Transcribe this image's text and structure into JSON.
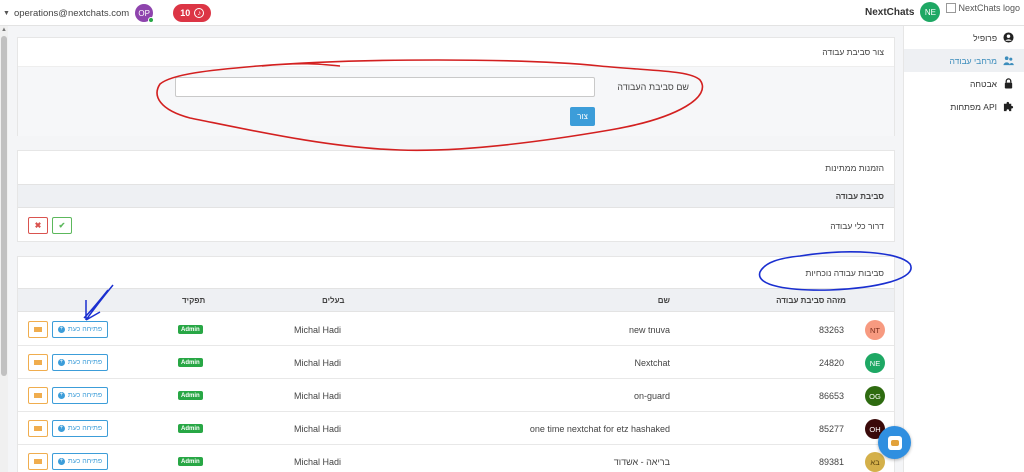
{
  "topbar": {
    "email": "operations@nextchats.com",
    "user_initials": "OP",
    "notifications_count": "10",
    "brand_name": "NextChats",
    "brand_initials": "NE",
    "logo_alt": "NextChats logo"
  },
  "sidebar": {
    "items": [
      {
        "label": "פרופיל",
        "icon": "user-circle-icon"
      },
      {
        "label": "מרחבי עבודה",
        "icon": "users-icon",
        "active": true
      },
      {
        "label": "אבטחה",
        "icon": "lock-icon"
      },
      {
        "label": "מפתחות API",
        "icon": "puzzle-icon"
      }
    ]
  },
  "create_workspace": {
    "title": "צור סביבת עבודה",
    "name_label": "שם סביבת העבודה",
    "name_value": "",
    "create_label": "צור"
  },
  "invitations": {
    "title": "הזמנות ממתינות",
    "column_header": "סביבת עבודה",
    "rows": [
      {
        "workspace": "דרור כלי עבודה",
        "reject_symbol": "✖",
        "accept_symbol": "✔"
      }
    ]
  },
  "workspaces": {
    "title": "סביבות עבודה נוכחיות",
    "columns": {
      "id": "מזהה סביבת עבודה",
      "name": "שם",
      "owners": "בעלים",
      "role": "תפקיד"
    },
    "open_label": "פתיחה כעת",
    "rows": [
      {
        "initials": "NT",
        "color": "#f79a80",
        "text_color": "#7a2e1c",
        "id": "83263",
        "name": "new tnuva",
        "owner": "Michal Hadi",
        "role": "Admin"
      },
      {
        "initials": "NE",
        "color": "#1ea864",
        "text_color": "#ffffff",
        "id": "24820",
        "name": "Nextchat",
        "owner": "Michal Hadi",
        "role": "Admin"
      },
      {
        "initials": "OG",
        "color": "#2e6b10",
        "text_color": "#ffffff",
        "id": "86653",
        "name": "on-guard",
        "owner": "Michal Hadi",
        "role": "Admin"
      },
      {
        "initials": "OH",
        "color": "#3a0a0a",
        "text_color": "#ffffff",
        "id": "85277",
        "name": "one time nextchat for etz hashaked",
        "owner": "Michal Hadi",
        "role": "Admin"
      },
      {
        "initials": "בא",
        "color": "#d4b04a",
        "text_color": "#5a4410",
        "id": "89381",
        "name": "בריאה - אשדוד",
        "owner": "Michal Hadi",
        "role": "Admin"
      }
    ]
  },
  "colors": {
    "primary": "#3c9dd9",
    "badge_green": "#28a745",
    "notif_red": "#dc3545",
    "user_avatar": "#8e44ad",
    "brand_avatar": "#1ea864",
    "online": "#28a745",
    "annot_red": "#d32020",
    "annot_blue": "#1a2fd0"
  }
}
